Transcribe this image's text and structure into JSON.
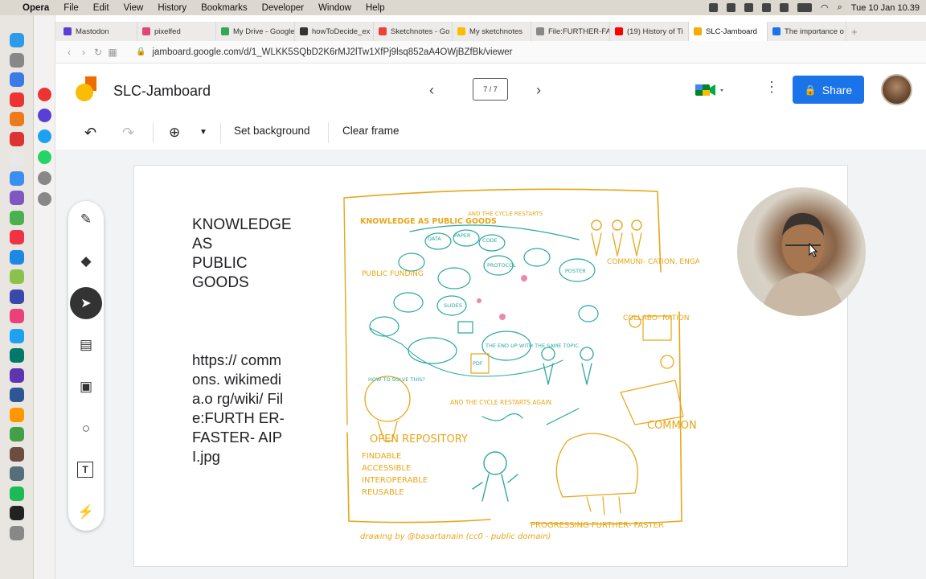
{
  "menubar": {
    "app": "Opera",
    "items": [
      "File",
      "Edit",
      "View",
      "History",
      "Bookmarks",
      "Developer",
      "Window",
      "Help"
    ],
    "clock": "Tue 10 Jan  10.39"
  },
  "tabs": [
    {
      "label": "Mastodon",
      "color": "#5b3fd4"
    },
    {
      "label": "pixelfed",
      "color": "#e0457b"
    },
    {
      "label": "My Drive - Google",
      "color": "#34a853"
    },
    {
      "label": "howToDecide_ex",
      "color": "#333333"
    },
    {
      "label": "Sketchnotes - Go",
      "color": "#ea4335"
    },
    {
      "label": "My sketchnotes",
      "color": "#fbbc04"
    },
    {
      "label": "File:FURTHER-FA",
      "color": "#888888"
    },
    {
      "label": "(19) History of Ti",
      "color": "#ff0000"
    },
    {
      "label": "SLC-Jamboard",
      "color": "#f9ab00"
    },
    {
      "label": "The importance o",
      "color": "#1a73e8"
    }
  ],
  "active_tab": 8,
  "address": {
    "url": "jamboard.google.com/d/1_WLKK5SQbD2K6rMJ2lTw1XfPj9lsq852aA4OWjBZfBk/viewer"
  },
  "header": {
    "title": "SLC-Jamboard",
    "frame_counter": "7 / 7",
    "share_label": "Share"
  },
  "toolbar": {
    "set_background": "Set background",
    "clear_frame": "Clear frame"
  },
  "frame": {
    "note_heading_lines": [
      "KNOWLEDGE",
      "AS",
      "PUBLIC",
      "GOODS"
    ],
    "note_link": "https:// commons. wikimedia.o rg/wiki/ File:FURTH ER-FASTER- AIPI.jpg"
  },
  "sketch": {
    "knowledge_title": "KNOWLEDGE AS PUBLIC GOODS",
    "cycle_top": "AND THE CYCLE RESTARTS",
    "communication": "COMMUNI- CATION, ENGAGEMENT",
    "collaboration": "COLLABO- RATION",
    "public_funding": "PUBLIC FUNDING",
    "open_repository": "OPEN REPOSITORY",
    "fair": [
      "FINDABLE",
      "ACCESSIBLE",
      "INTEROPERABLE",
      "REUSABLE"
    ],
    "common_goals": "COMMON GOALS",
    "progressing": "PROGRESSING FURTHER- FASTER",
    "credit": "drawing by @basartanain (cc0 - public domain)",
    "cycle_bottom": "AND THE CYCLE RESTARTS AGAIN",
    "bubbles": [
      "DATA",
      "PAPER",
      "CODE",
      "POSTER",
      "SLIDES",
      "PROTOCOL",
      "HOW TO SOLVE THIS?",
      "THE END UP WITH THE SAME TOPIC",
      "PDF"
    ],
    "accent_orange": "#e8a618",
    "accent_teal": "#2aa8a0"
  },
  "colors": {
    "share": "#1a73e8"
  }
}
